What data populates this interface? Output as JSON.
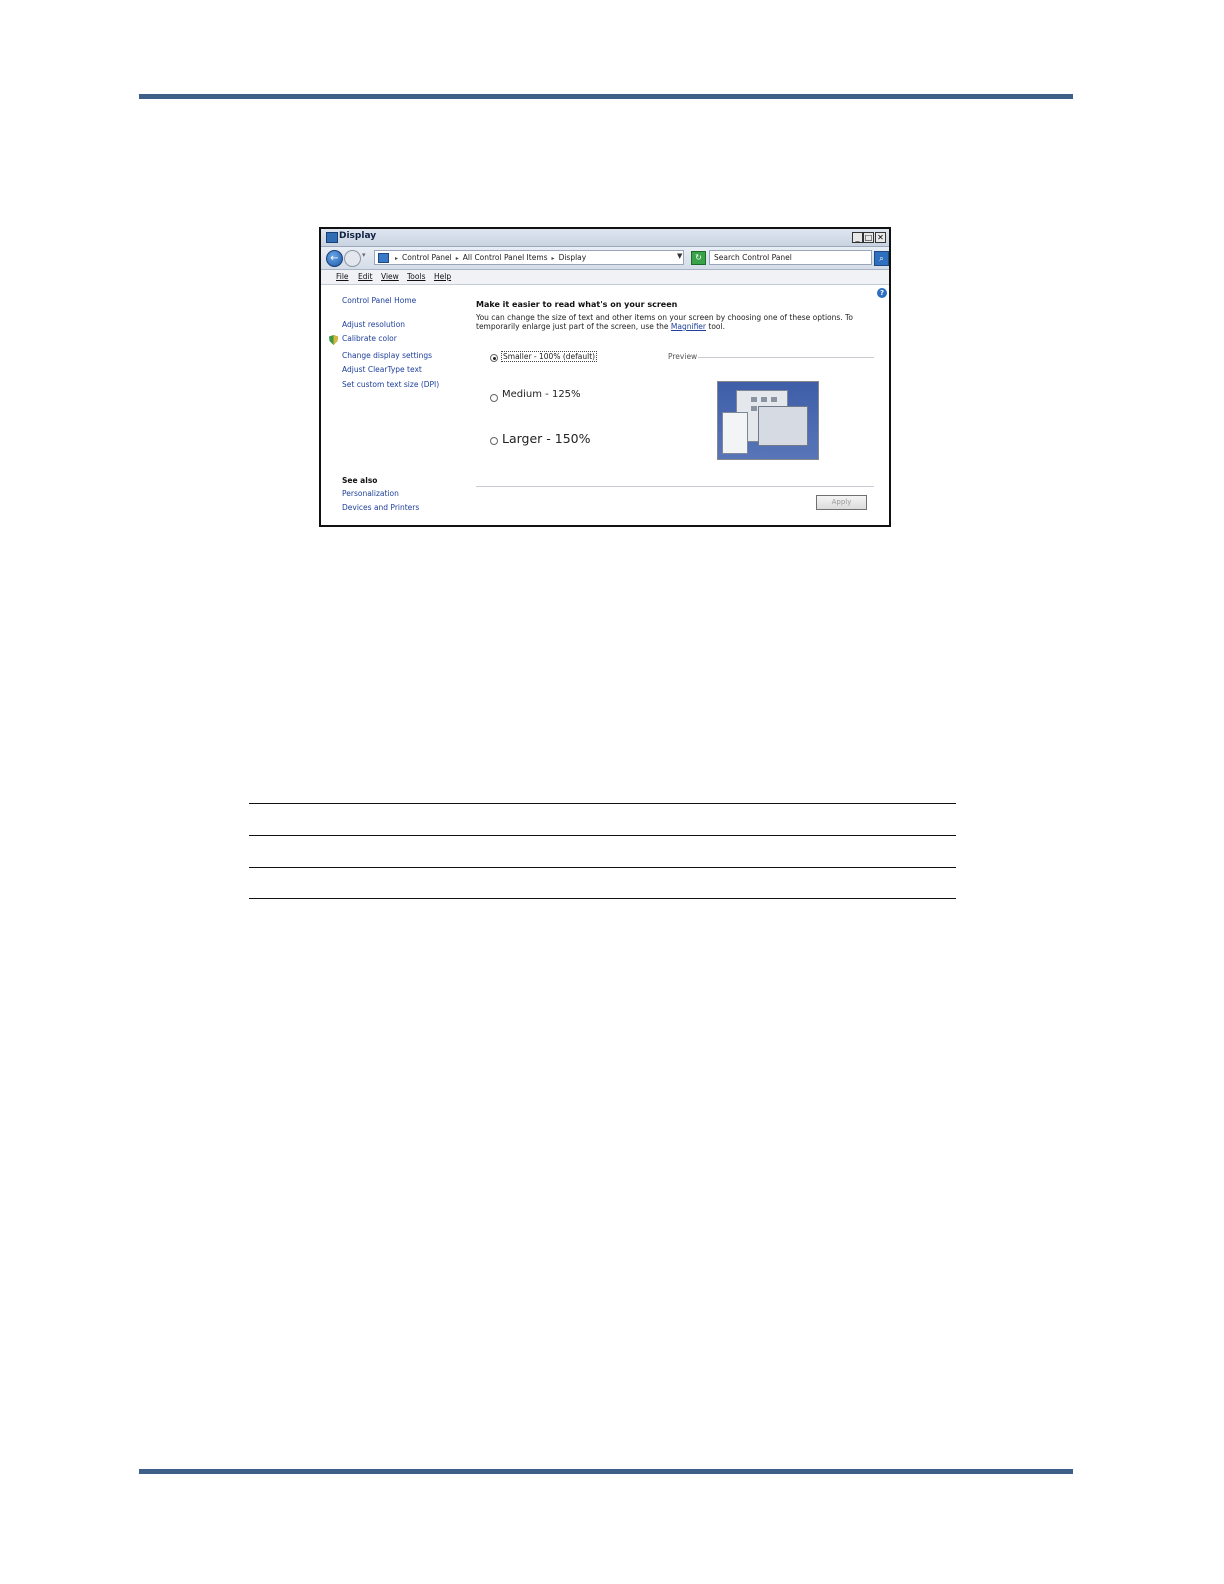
{
  "window": {
    "title": "Display",
    "controls": {
      "minimize": "_",
      "maximize": "□",
      "close": "✕"
    }
  },
  "address": {
    "breadcrumbs": [
      "Control Panel",
      "All Control Panel Items",
      "Display"
    ],
    "search_placeholder": "Search Control Panel"
  },
  "menu": [
    "File",
    "Edit",
    "View",
    "Tools",
    "Help"
  ],
  "sidebar": {
    "home": "Control Panel Home",
    "links": [
      "Adjust resolution",
      "Calibrate color",
      "Change display settings",
      "Adjust ClearType text",
      "Set custom text size (DPI)"
    ],
    "see_also_heading": "See also",
    "see_also_links": [
      "Personalization",
      "Devices and Printers"
    ]
  },
  "main": {
    "heading": "Make it easier to read what's on your screen",
    "description_pre": "You can change the size of text and other items on your screen by choosing one of these options. To temporarily enlarge just part of the screen, use the ",
    "description_link": "Magnifier",
    "description_post": " tool.",
    "options": [
      {
        "label": "Smaller - 100% (default)",
        "selected": true
      },
      {
        "label": "Medium - 125%",
        "selected": false
      },
      {
        "label": "Larger - 150%",
        "selected": false
      }
    ],
    "preview_label": "Preview",
    "apply_label": "Apply"
  },
  "icons": {
    "help": "?",
    "back": "←",
    "refresh": "↻",
    "search": "⌕"
  },
  "colors": {
    "page_rule": "#3e5f87",
    "link": "#1e3f9a"
  }
}
